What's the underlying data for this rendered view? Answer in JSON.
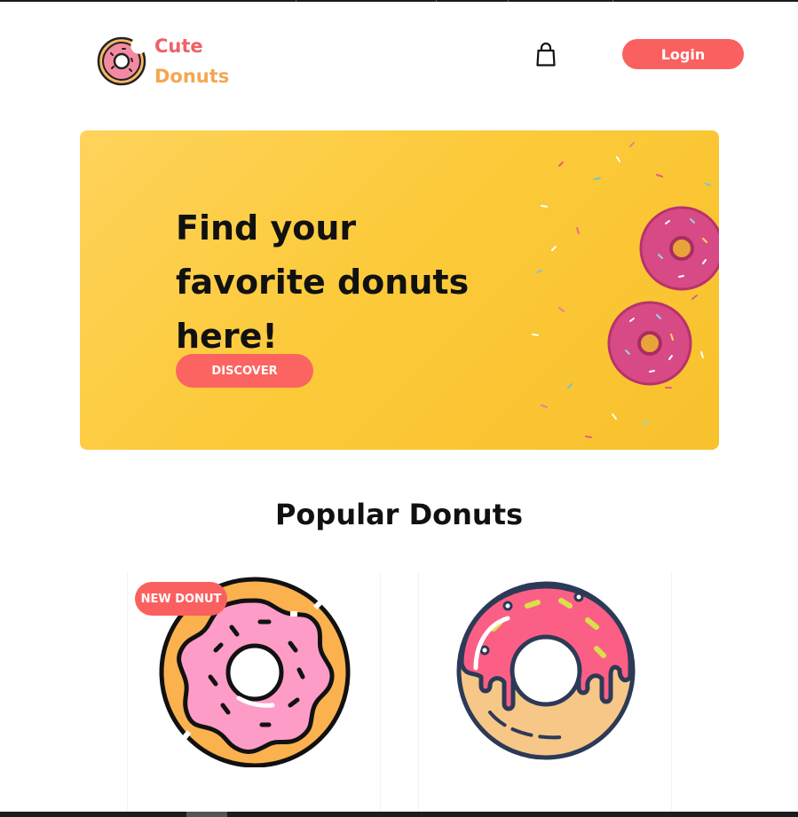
{
  "header": {
    "brand_line1": "Cute",
    "brand_line2": "Donuts",
    "logo_icon": "donut-logo-icon",
    "cart_icon": "shopping-bag-icon",
    "login_label": "Login"
  },
  "hero": {
    "title": "Find your favorite donuts here!",
    "button_label": "DISCOVER",
    "colors": {
      "background": "#fcca3a",
      "button": "#fb6460"
    }
  },
  "popular": {
    "title": "Popular Donuts",
    "cards": [
      {
        "badge": "NEW DONUT",
        "icon": "pink-frosted-donut-icon"
      },
      {
        "icon": "drip-frosted-donut-icon"
      }
    ]
  },
  "colors": {
    "accent": "#fb6060",
    "brand_secondary": "#f5a64f"
  }
}
